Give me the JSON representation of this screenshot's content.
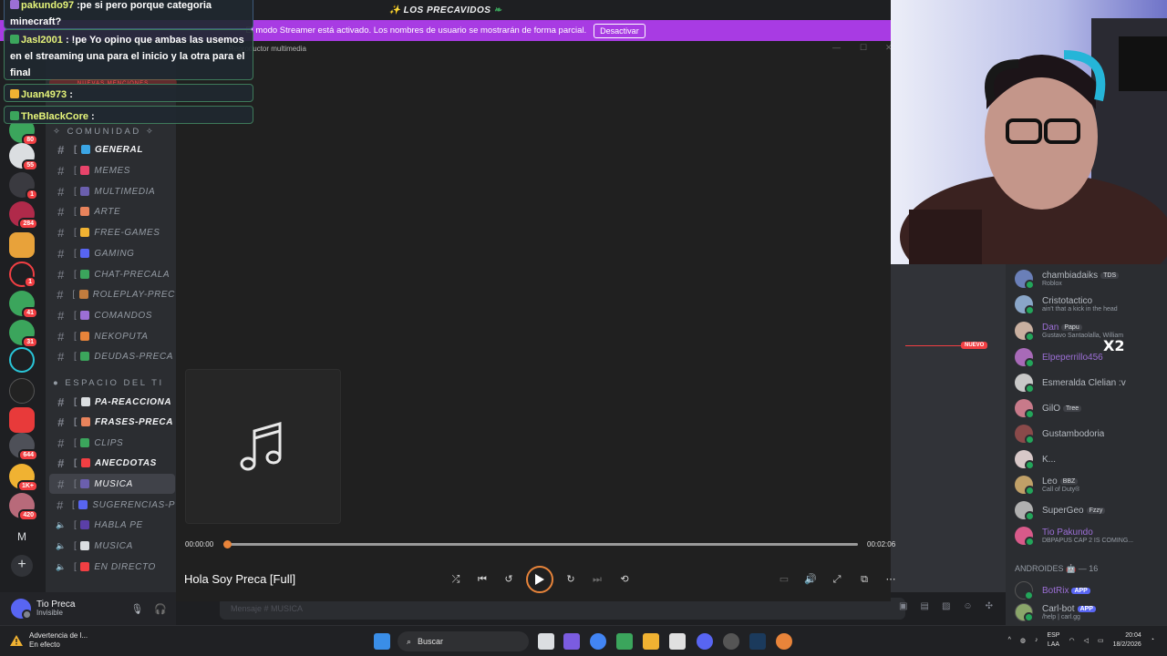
{
  "server_title": "LOS PRECAVIDOS",
  "streamer_banner": {
    "text": "El modo Streamer está activado. Los nombres de usuario se mostrarán de forma parcial.",
    "button": "Desactivar"
  },
  "rail_badges": [
    "80",
    "55",
    "1",
    "284",
    "1",
    "41",
    "31",
    "644",
    "1K+",
    "420"
  ],
  "categories": {
    "comunidad": "COMUNIDAD",
    "espacio": "ESPACIO DEL TI"
  },
  "channels": [
    {
      "name": "GENERAL",
      "bright": true,
      "color": "#3ba5e4",
      "brk": "["
    },
    {
      "name": "MEMES",
      "color": "#e8446b",
      "brk": "["
    },
    {
      "name": "MULTIMEDIA",
      "color": "#6b5fae",
      "brk": "["
    },
    {
      "name": "ARTE",
      "color": "#e8835c",
      "brk": "["
    },
    {
      "name": "FREE-GAMES",
      "color": "#f0b232",
      "brk": "["
    },
    {
      "name": "GAMING",
      "color": "#5865f2",
      "brk": "["
    },
    {
      "name": "CHAT-PRECALA",
      "color": "#3ba55c",
      "brk": "["
    },
    {
      "name": "ROLEPLAY-PREC",
      "color": "#c27c3e",
      "brk": "["
    },
    {
      "name": "COMANDOS",
      "color": "#9c6fd6",
      "brk": "["
    },
    {
      "name": "NEKOPUTA",
      "color": "#e8843a",
      "brk": "["
    },
    {
      "name": "DEUDAS-PRECA",
      "color": "#3ba55c",
      "brk": "["
    },
    {
      "name": "PA-REACCIONA",
      "bright": true,
      "color": "#dbdee1",
      "brk": "["
    },
    {
      "name": "FRASES-PRECA",
      "bright": true,
      "color": "#e8835c",
      "brk": "["
    },
    {
      "name": "CLIPS",
      "color": "#3ba55c",
      "brk": "["
    },
    {
      "name": "ANECDOTAS",
      "bright": true,
      "color": "#f23f43",
      "brk": "["
    },
    {
      "name": "MUSICA",
      "active": true,
      "color": "#6b5fae",
      "brk": "["
    },
    {
      "name": "SUGERENCIAS-P",
      "color": "#5865f2",
      "brk": "["
    },
    {
      "name": "HABLA PE",
      "voice": true,
      "color": "#5b3fa8",
      "brk": "["
    },
    {
      "name": "MUSICA",
      "voice": true,
      "color": "#dbdee1",
      "brk": "["
    },
    {
      "name": "EN DIRECTO",
      "voice": true,
      "color": "#f23f43",
      "brk": "["
    }
  ],
  "user": {
    "name": "Tio Preca",
    "status": "Invisible"
  },
  "player": {
    "window_title": "Reproductor multimedia",
    "elapsed": "00:00:00",
    "duration": "00:02:06",
    "progress": 0.0,
    "song_title": "Hola Soy Preca [Full]"
  },
  "chat_input_placeholder": "Mensaje #  MUSICA",
  "new_label": "NUEVO",
  "x2_text": "X2",
  "members": [
    {
      "name": "chambiadaiks",
      "tag": "TDS",
      "sub": "Roblox",
      "color": "#b5bac1",
      "av": "#6a7fb8"
    },
    {
      "name": "Cristotactico",
      "sub": "ain't that a kick in the head",
      "color": "#b5bac1",
      "av": "#8aa6c8"
    },
    {
      "name": "Dan",
      "tag": "Papu",
      "sub": "Gustavo Santaolalla, William",
      "color": "#9c6fd6",
      "av": "#c9b0a0"
    },
    {
      "name": "Elpeperrillo456",
      "color": "#9c6fd6",
      "av": "#a86ab8"
    },
    {
      "name": "Esmeralda Clelian :v",
      "color": "#b5bac1",
      "av": "#c8c8c8"
    },
    {
      "name": "GilO",
      "tag": "Tree",
      "color": "#b5bac1",
      "av": "#c87a8a"
    },
    {
      "name": "Gustambodoria",
      "color": "#b5bac1",
      "av": "#8a4a4a"
    },
    {
      "name": "K...",
      "color": "#b5bac1",
      "av": "#d8c8c8"
    },
    {
      "name": "Leo",
      "tag": "BBZ",
      "sub": "Call of Duty®",
      "color": "#b5bac1",
      "av": "#c0a068"
    },
    {
      "name": "SuperGeo",
      "tag": "Fzzy",
      "color": "#b5bac1",
      "av": "#b0b0b0"
    },
    {
      "name": "Tio Pakundo",
      "sub": "DBPAPUS CAP 2 IS COMING...",
      "color": "#9c6fd6",
      "av": "#d85a8a"
    }
  ],
  "role_header": "ANDROIDES",
  "role_count": "16",
  "bots": [
    {
      "name": "BotRix",
      "tag": "APP",
      "color": "#9c6fd6",
      "av": "#2b2d31"
    },
    {
      "name": "Carl-bot",
      "tag": "APP",
      "sub": "/help | carl.gg",
      "color": "#b5bac1",
      "av": "#8aa66a"
    }
  ],
  "overlay": [
    {
      "user": "pakundo97",
      "text": " :pe si pero porque categoria minecraft?"
    },
    {
      "user": "Jasl2001",
      "text": " : !pe Yo opino que ambas las usemos en el streaming una para el inicio y la otra para el final"
    },
    {
      "user": "Juan4973",
      "text": " :"
    },
    {
      "user": "TheBlackCore",
      "text": " :"
    }
  ],
  "overlay_faint": "NUEVAS MENCIONES",
  "taskbar": {
    "warning_title": "Advertencia de l...",
    "warning_sub": "En efecto",
    "search": "Buscar",
    "lang_top": "ESP",
    "lang_bottom": "LAA",
    "time": "20:04",
    "date": "18/2/2026"
  }
}
